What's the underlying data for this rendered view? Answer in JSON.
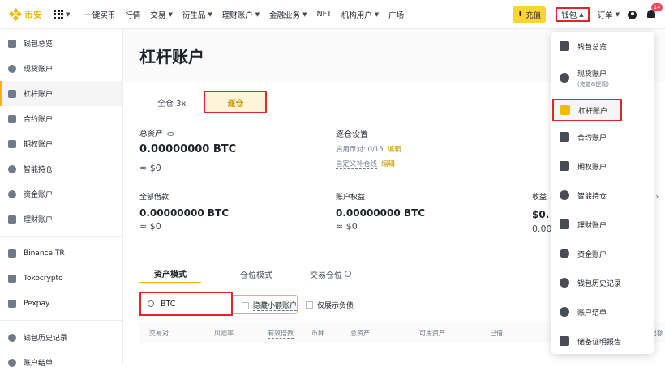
{
  "topbar": {
    "logo_text": "币安",
    "nav": [
      "一键买币",
      "行情",
      "交易",
      "衍生品",
      "理财账户",
      "金融业务",
      "NFT",
      "机构用户",
      "广场"
    ],
    "deposit_label": "充值",
    "wallet_label": "钱包",
    "orders_label": "订单",
    "notification_count": "14"
  },
  "sidebar": {
    "items": [
      {
        "label": "钱包总览",
        "icon": "grid-icon"
      },
      {
        "label": "现货账户",
        "icon": "spot-icon"
      },
      {
        "label": "杠杆账户",
        "icon": "margin-icon",
        "active": true
      },
      {
        "label": "合约账户",
        "icon": "futures-icon"
      },
      {
        "label": "期权账户",
        "icon": "options-icon"
      },
      {
        "label": "智能持仓",
        "icon": "smart-icon"
      },
      {
        "label": "资金账户",
        "icon": "funding-icon"
      },
      {
        "label": "理财账户",
        "icon": "earn-icon"
      }
    ],
    "partner_items": [
      {
        "label": "Binance TR",
        "icon": "binance-tr-icon"
      },
      {
        "label": "Tokocrypto",
        "icon": "tokocrypto-icon"
      },
      {
        "label": "Pexpay",
        "icon": "pexpay-icon"
      }
    ],
    "bottom_items": [
      {
        "label": "钱包历史记录",
        "icon": "history-icon"
      },
      {
        "label": "账户结单",
        "icon": "statement-icon"
      }
    ]
  },
  "main": {
    "title": "杠杆账户",
    "mode_tabs": {
      "cross": "全仓 3x",
      "isolated": "逐仓"
    },
    "total_assets_label": "总资产",
    "total_assets_btc": "0.00000000 BTC",
    "total_assets_usd": "≈ $0",
    "isolated_settings_label": "逐仓设置",
    "enabled_pairs_label": "启用币对: 0/15",
    "edit_label": "编辑",
    "custom_line_label": "自定义补仓线",
    "custom_edit_label": "编辑",
    "total_borrowed_label": "全部借款",
    "total_borrowed_btc": "0.00000000 BTC",
    "total_borrowed_usd": "≈ $0",
    "equity_label": "账户权益",
    "equity_btc": "0.00000000 BTC",
    "equity_usd": "≈ $0",
    "earnings_label": "收益",
    "earnings_val1": "$0.",
    "earnings_val2": "0.00",
    "view_tabs": [
      "资产模式",
      "仓位模式",
      "交易仓位"
    ],
    "search_value": "BTC",
    "hide_small_label": "隐藏小额账户",
    "liabilities_only_label": "仅展示负债",
    "table_headers": [
      "交易对",
      "风险率",
      "有效倍数",
      "币种",
      "总资产",
      "可用资产",
      "已借",
      "出额"
    ]
  },
  "wallet_menu": {
    "items": [
      {
        "label": "钱包总览",
        "sub": "",
        "icon": "overview-icon"
      },
      {
        "label": "现货账户",
        "sub": "(充值&提现)",
        "icon": "spot-icon"
      },
      {
        "label": "杠杆账户",
        "sub": "",
        "icon": "margin-icon"
      },
      {
        "label": "合约账户",
        "sub": "",
        "icon": "futures-icon"
      },
      {
        "label": "期权账户",
        "sub": "",
        "icon": "options-icon"
      },
      {
        "label": "智能持仓",
        "sub": "",
        "icon": "smart-icon"
      },
      {
        "label": "理财账户",
        "sub": "",
        "icon": "earn-icon"
      },
      {
        "label": "资金账户",
        "sub": "",
        "icon": "funding-icon"
      },
      {
        "label": "钱包历史记录",
        "sub": "",
        "icon": "history-icon"
      },
      {
        "label": "账户结单",
        "sub": "",
        "icon": "statement-icon"
      },
      {
        "label": "储备证明报告",
        "sub": "",
        "icon": "report-icon"
      }
    ]
  },
  "colors": {
    "accent": "#f0b90b",
    "highlight_box": "#e0262b",
    "text": "#1e2329"
  }
}
